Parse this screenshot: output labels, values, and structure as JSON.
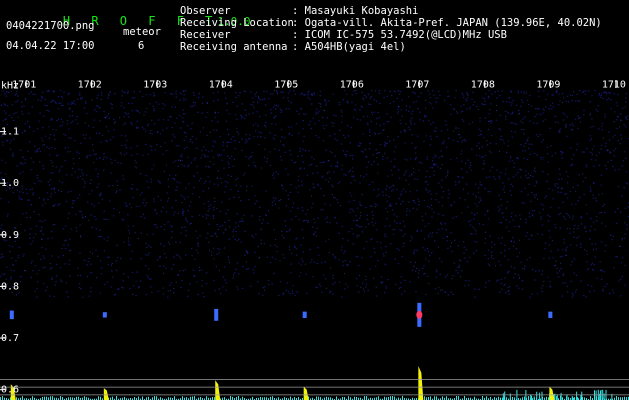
{
  "app": {
    "logo": "H R O F F T",
    "version": "1.0.0"
  },
  "file": {
    "name": "0404221700.png",
    "datetime": "04.04.22 17:00"
  },
  "meteor": {
    "label": "meteor",
    "count": "6"
  },
  "info": [
    {
      "label": "Observer",
      "value": ": Masayuki Kobayashi"
    },
    {
      "label": "Receiving Location",
      "value": ": Ogata-vill. Akita-Pref. JAPAN (139.96E, 40.02N)"
    },
    {
      "label": "Receiver",
      "value": ": ICOM IC-575 53.7492(@LCD)MHz USB"
    },
    {
      "label": "Receiving antenna",
      "value": ": A504HB(yagi 4el)"
    }
  ],
  "spectrogram": {
    "unit": "kHz",
    "time_ticks": [
      "1701",
      "1702",
      "1703",
      "1704",
      "1705",
      "1706",
      "1707",
      "1708",
      "1709",
      "1710"
    ],
    "freq_ticks": [
      "1.1",
      "1.0",
      "0.9",
      "0.8",
      "0.7",
      "0.6"
    ],
    "freq_range_khz": [
      0.58,
      1.2
    ],
    "time_range_min": [
      1700.6,
      1710.2
    ],
    "beacon_khz": 0.745,
    "meteor_echoes": [
      {
        "time": 1700.78,
        "strength": 0.3
      },
      {
        "time": 1702.2,
        "strength": 0.15
      },
      {
        "time": 1703.9,
        "strength": 0.45
      },
      {
        "time": 1705.25,
        "strength": 0.2
      },
      {
        "time": 1707.0,
        "strength": 1.0
      },
      {
        "time": 1709.0,
        "strength": 0.2
      }
    ],
    "colors": {
      "background": "#000000",
      "noise": "#141a78",
      "echo": "#3c6cff",
      "peak": "#ff3a66",
      "tick": "#ffffff",
      "histogram": "#f2f20a",
      "baseline": "#33e6e6"
    }
  }
}
